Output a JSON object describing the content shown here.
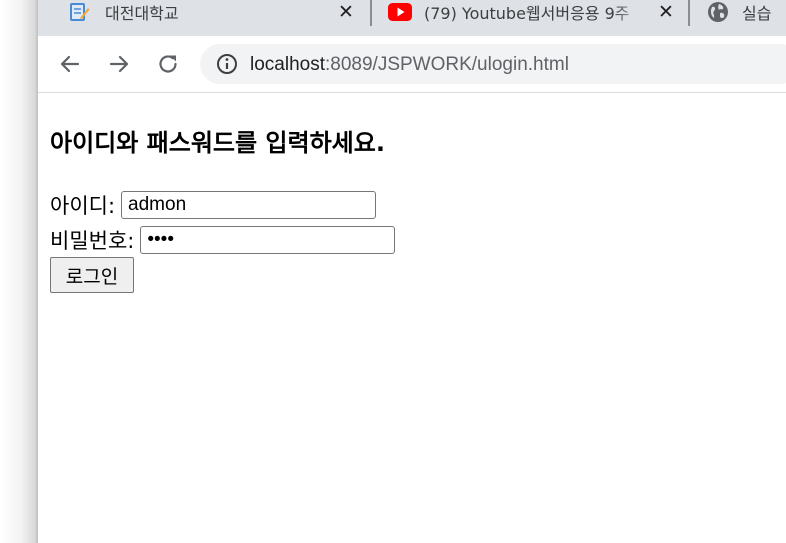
{
  "tabs": [
    {
      "title": "대전대학교",
      "icon": "notepad-icon"
    },
    {
      "title": "(79) Youtube웹서버응용 9주",
      "icon": "youtube-icon",
      "brand_color": "#ff0000"
    },
    {
      "title": "실습",
      "icon": "globe-icon"
    }
  ],
  "tab_close_glyph": "✕",
  "address_bar": {
    "host": "localhost",
    "rest": ":8089/JSPWORK/ulogin.html"
  },
  "page": {
    "heading": "아이디와 패스워드를 입력하세요.",
    "id_label": "아이디:",
    "id_value": "admon",
    "pw_label": "비밀번호:",
    "pw_value": "••••",
    "login_button": "로그인"
  }
}
